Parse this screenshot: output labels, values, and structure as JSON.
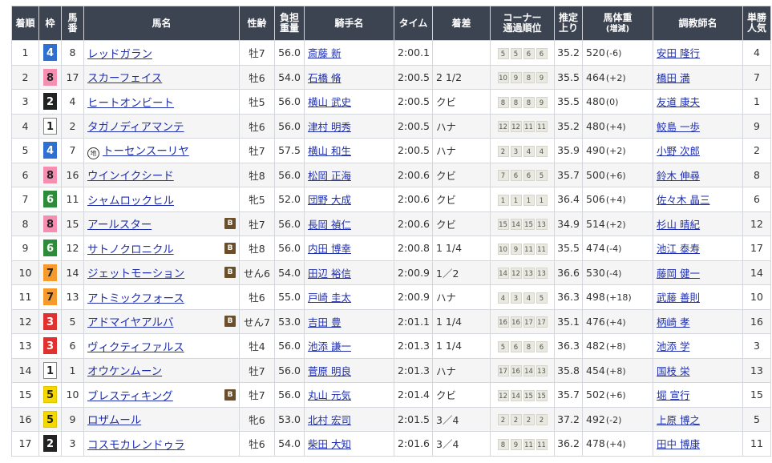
{
  "headers": {
    "rank": "着順",
    "waku": "枠",
    "umaban": [
      "馬",
      "番"
    ],
    "horse": "馬名",
    "sexage": "性齢",
    "weight": [
      "負担",
      "重量"
    ],
    "jockey": "騎手名",
    "time": "タイム",
    "margin": "着差",
    "corner": [
      "コーナー",
      "通過順位"
    ],
    "last3f": [
      "推定",
      "上り"
    ],
    "bodyweight": [
      "馬体重",
      "(増減)"
    ],
    "trainer": "調教師名",
    "odds_rank": [
      "単勝",
      "人気"
    ]
  },
  "colors": {
    "header_bg": "#3c4451",
    "link": "#1f2fae",
    "blinker_bg": "#6b4f2a"
  },
  "waku_colors": {
    "1": {
      "bg": "#ffffff",
      "fg": "#222222",
      "border": "#888888"
    },
    "2": {
      "bg": "#222222",
      "fg": "#ffffff",
      "border": "#222222"
    },
    "3": {
      "bg": "#e03131",
      "fg": "#ffffff",
      "border": "#e03131"
    },
    "4": {
      "bg": "#2f6fd0",
      "fg": "#ffffff",
      "border": "#2f6fd0"
    },
    "5": {
      "bg": "#f5d800",
      "fg": "#222222",
      "border": "#e0c400"
    },
    "6": {
      "bg": "#2e8b3a",
      "fg": "#ffffff",
      "border": "#2e8b3a"
    },
    "7": {
      "bg": "#f59a2c",
      "fg": "#222222",
      "border": "#f59a2c"
    },
    "8": {
      "bg": "#f48fb1",
      "fg": "#222222",
      "border": "#f48fb1"
    }
  },
  "blinker_label": "B",
  "chiho_label": "地",
  "rows": [
    {
      "rank": "1",
      "waku": "4",
      "umaban": "8",
      "horse": "レッドガラン",
      "blinker": false,
      "chiho": false,
      "sexage": "牡7",
      "weight": "56.0",
      "jockey": "斎藤 新",
      "time": "2:00.1",
      "margin": "",
      "corner": [
        "5",
        "5",
        "6",
        "6"
      ],
      "last3f": "35.2",
      "bw": "520",
      "bwchg": "(-6)",
      "trainer": "安田 隆行",
      "pop": "4"
    },
    {
      "rank": "2",
      "waku": "8",
      "umaban": "17",
      "horse": "スカーフェイス",
      "blinker": false,
      "chiho": false,
      "sexage": "牡6",
      "weight": "54.0",
      "jockey": "石橋 脩",
      "time": "2:00.5",
      "margin": "2 1/2",
      "corner": [
        "10",
        "9",
        "8",
        "9"
      ],
      "last3f": "35.5",
      "bw": "464",
      "bwchg": "(+2)",
      "trainer": "橋田 満",
      "pop": "7"
    },
    {
      "rank": "3",
      "waku": "2",
      "umaban": "4",
      "horse": "ヒートオンビート",
      "blinker": false,
      "chiho": false,
      "sexage": "牡5",
      "weight": "56.0",
      "jockey": "横山 武史",
      "time": "2:00.5",
      "margin": "クビ",
      "corner": [
        "8",
        "8",
        "8",
        "9"
      ],
      "last3f": "35.5",
      "bw": "480",
      "bwchg": "(0)",
      "trainer": "友道 康夫",
      "pop": "1"
    },
    {
      "rank": "4",
      "waku": "1",
      "umaban": "2",
      "horse": "タガノディアマンテ",
      "blinker": false,
      "chiho": false,
      "sexage": "牡6",
      "weight": "56.0",
      "jockey": "津村 明秀",
      "time": "2:00.5",
      "margin": "ハナ",
      "corner": [
        "12",
        "12",
        "11",
        "11"
      ],
      "last3f": "35.2",
      "bw": "480",
      "bwchg": "(+4)",
      "trainer": "鮫島 一歩",
      "pop": "9"
    },
    {
      "rank": "5",
      "waku": "4",
      "umaban": "7",
      "horse": "トーセンスーリヤ",
      "blinker": false,
      "chiho": true,
      "sexage": "牡7",
      "weight": "57.5",
      "jockey": "横山 和生",
      "time": "2:00.5",
      "margin": "ハナ",
      "corner": [
        "2",
        "3",
        "4",
        "4"
      ],
      "last3f": "35.9",
      "bw": "490",
      "bwchg": "(+2)",
      "trainer": "小野 次郎",
      "pop": "2"
    },
    {
      "rank": "6",
      "waku": "8",
      "umaban": "16",
      "horse": "ウインイクシード",
      "blinker": false,
      "chiho": false,
      "sexage": "牡8",
      "weight": "56.0",
      "jockey": "松岡 正海",
      "time": "2:00.6",
      "margin": "クビ",
      "corner": [
        "7",
        "6",
        "6",
        "5"
      ],
      "last3f": "35.7",
      "bw": "500",
      "bwchg": "(+6)",
      "trainer": "鈴木 伸尋",
      "pop": "8"
    },
    {
      "rank": "7",
      "waku": "6",
      "umaban": "11",
      "horse": "シャムロックヒル",
      "blinker": false,
      "chiho": false,
      "sexage": "牝5",
      "weight": "52.0",
      "jockey": "団野 大成",
      "time": "2:00.6",
      "margin": "クビ",
      "corner": [
        "1",
        "1",
        "1",
        "1"
      ],
      "last3f": "36.4",
      "bw": "506",
      "bwchg": "(+4)",
      "trainer": "佐々木 晶三",
      "pop": "6"
    },
    {
      "rank": "8",
      "waku": "8",
      "umaban": "15",
      "horse": "アールスター",
      "blinker": true,
      "chiho": false,
      "sexage": "牡7",
      "weight": "56.0",
      "jockey": "長岡 禎仁",
      "time": "2:00.6",
      "margin": "クビ",
      "corner": [
        "15",
        "14",
        "15",
        "13"
      ],
      "last3f": "34.9",
      "bw": "514",
      "bwchg": "(+2)",
      "trainer": "杉山 晴紀",
      "pop": "12"
    },
    {
      "rank": "9",
      "waku": "6",
      "umaban": "12",
      "horse": "サトノクロニクル",
      "blinker": true,
      "chiho": false,
      "sexage": "牡8",
      "weight": "56.0",
      "jockey": "内田 博幸",
      "time": "2:00.8",
      "margin": "1 1/4",
      "corner": [
        "10",
        "9",
        "11",
        "11"
      ],
      "last3f": "35.5",
      "bw": "474",
      "bwchg": "(-4)",
      "trainer": "池江 泰寿",
      "pop": "17"
    },
    {
      "rank": "10",
      "waku": "7",
      "umaban": "14",
      "horse": "ジェットモーション",
      "blinker": true,
      "chiho": false,
      "sexage": "せん6",
      "weight": "54.0",
      "jockey": "田辺 裕信",
      "time": "2:00.9",
      "margin": "1／2",
      "corner": [
        "14",
        "12",
        "13",
        "13"
      ],
      "last3f": "36.6",
      "bw": "530",
      "bwchg": "(-4)",
      "trainer": "藤岡 健一",
      "pop": "14"
    },
    {
      "rank": "11",
      "waku": "7",
      "umaban": "13",
      "horse": "アトミックフォース",
      "blinker": false,
      "chiho": false,
      "sexage": "牡6",
      "weight": "55.0",
      "jockey": "戸崎 圭太",
      "time": "2:00.9",
      "margin": "ハナ",
      "corner": [
        "4",
        "3",
        "4",
        "5"
      ],
      "last3f": "36.3",
      "bw": "498",
      "bwchg": "(+18)",
      "trainer": "武藤 善則",
      "pop": "10"
    },
    {
      "rank": "12",
      "waku": "3",
      "umaban": "5",
      "horse": "アドマイヤアルバ",
      "blinker": true,
      "chiho": false,
      "sexage": "せん7",
      "weight": "53.0",
      "jockey": "吉田 豊",
      "time": "2:01.1",
      "margin": "1 1/4",
      "corner": [
        "16",
        "16",
        "17",
        "17"
      ],
      "last3f": "35.1",
      "bw": "476",
      "bwchg": "(+4)",
      "trainer": "柄崎 孝",
      "pop": "16"
    },
    {
      "rank": "13",
      "waku": "3",
      "umaban": "6",
      "horse": "ヴィクティファルス",
      "blinker": false,
      "chiho": false,
      "sexage": "牡4",
      "weight": "56.0",
      "jockey": "池添 謙一",
      "time": "2:01.3",
      "margin": "1 1/4",
      "corner": [
        "5",
        "6",
        "8",
        "6"
      ],
      "last3f": "36.3",
      "bw": "482",
      "bwchg": "(+8)",
      "trainer": "池添 学",
      "pop": "3"
    },
    {
      "rank": "14",
      "waku": "1",
      "umaban": "1",
      "horse": "オウケンムーン",
      "blinker": false,
      "chiho": false,
      "sexage": "牡7",
      "weight": "56.0",
      "jockey": "菅原 明良",
      "time": "2:01.3",
      "margin": "ハナ",
      "corner": [
        "17",
        "16",
        "14",
        "13"
      ],
      "last3f": "35.8",
      "bw": "454",
      "bwchg": "(+8)",
      "trainer": "国枝 栄",
      "pop": "13"
    },
    {
      "rank": "15",
      "waku": "5",
      "umaban": "10",
      "horse": "ブレスティキング",
      "blinker": true,
      "chiho": false,
      "sexage": "牡7",
      "weight": "56.0",
      "jockey": "丸山 元気",
      "time": "2:01.4",
      "margin": "クビ",
      "corner": [
        "12",
        "14",
        "15",
        "15"
      ],
      "last3f": "35.7",
      "bw": "502",
      "bwchg": "(+6)",
      "trainer": "堀 宣行",
      "pop": "15"
    },
    {
      "rank": "16",
      "waku": "5",
      "umaban": "9",
      "horse": "ロザムール",
      "blinker": false,
      "chiho": false,
      "sexage": "牝6",
      "weight": "53.0",
      "jockey": "北村 宏司",
      "time": "2:01.5",
      "margin": "3／4",
      "corner": [
        "2",
        "2",
        "2",
        "2"
      ],
      "last3f": "37.2",
      "bw": "492",
      "bwchg": "(-2)",
      "trainer": "上原 博之",
      "pop": "5"
    },
    {
      "rank": "17",
      "waku": "2",
      "umaban": "3",
      "horse": "コスモカレンドゥラ",
      "blinker": false,
      "chiho": false,
      "sexage": "牡6",
      "weight": "54.0",
      "jockey": "柴田 大知",
      "time": "2:01.6",
      "margin": "3／4",
      "corner": [
        "8",
        "9",
        "11",
        "11"
      ],
      "last3f": "36.2",
      "bw": "478",
      "bwchg": "(+4)",
      "trainer": "田中 博康",
      "pop": "11"
    }
  ]
}
